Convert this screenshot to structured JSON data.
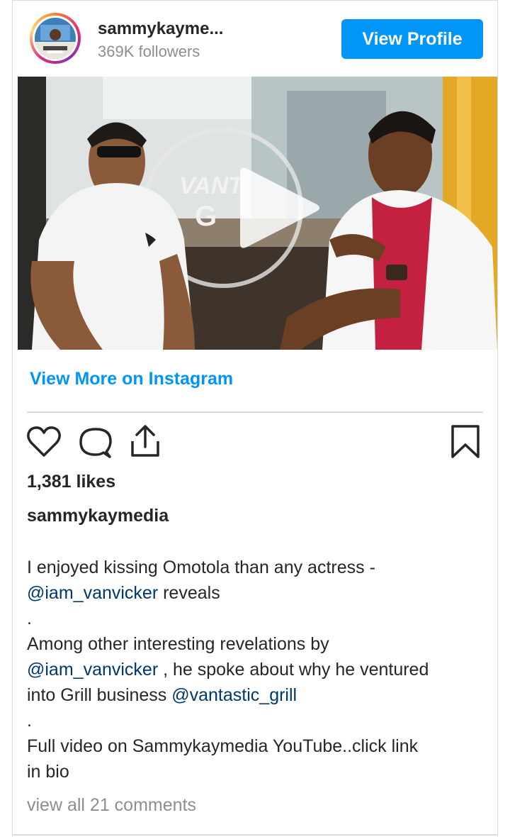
{
  "header": {
    "username": "sammykayme...",
    "followers": "369K followers",
    "view_profile_label": "View Profile"
  },
  "media": {
    "sign_text": "VANT",
    "sign_subtext": "G"
  },
  "view_more_label": "View More on Instagram",
  "actions": {
    "like": "heart-icon",
    "comment": "comment-icon",
    "share": "share-icon",
    "save": "bookmark-icon"
  },
  "likes": "1,381 likes",
  "caption": {
    "username": "sammykaymedia",
    "line1": "I enjoyed kissing Omotola than any actress -",
    "line2_mention": "@iam_vanvicker",
    "line2_text": " reveals",
    "line3": ".",
    "line4": "Among other interesting revelations by",
    "line5_mention": "@iam_vanvicker",
    "line5_text": " , he spoke about why he ventured",
    "line6_text": "into Grill business ",
    "line6_mention": "@vantastic_grill",
    "line7": ".",
    "line8": "Full video on Sammykaymedia YouTube..click link",
    "line9": "in bio"
  },
  "comments_label": "view all 21 comments",
  "colors": {
    "accent": "#0095f6",
    "mention": "#00376b",
    "text": "#262626",
    "muted": "#8e8e8e"
  }
}
